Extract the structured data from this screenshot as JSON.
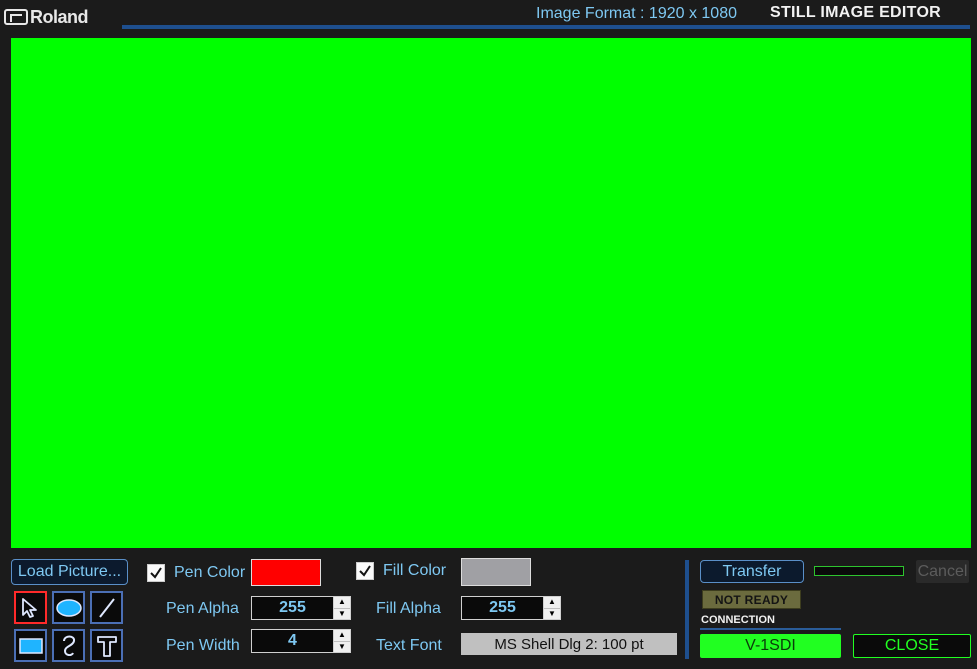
{
  "header": {
    "logo_text": "Roland",
    "image_format": "Image Format : 1920 x 1080",
    "title": "STILL IMAGE EDITOR",
    "accent_color": "#1e4f8e"
  },
  "canvas": {
    "background_color": "#00ff00"
  },
  "toolbar": {
    "load_picture_label": "Load Picture...",
    "tools": [
      {
        "name": "select-tool",
        "icon": "arrow-pointer-icon",
        "selected": true
      },
      {
        "name": "ellipse-tool",
        "icon": "ellipse-icon",
        "selected": false
      },
      {
        "name": "line-tool",
        "icon": "line-icon",
        "selected": false
      },
      {
        "name": "rectangle-tool",
        "icon": "rectangle-icon",
        "selected": false
      },
      {
        "name": "freehand-tool",
        "icon": "freehand-icon",
        "selected": false
      },
      {
        "name": "text-tool",
        "icon": "text-icon",
        "selected": false
      }
    ]
  },
  "pen": {
    "color_label": "Pen Color",
    "color_checked": true,
    "color_value": "#ff0000",
    "alpha_label": "Pen Alpha",
    "alpha_value": "255",
    "width_label": "Pen Width",
    "width_value": "4"
  },
  "fill": {
    "color_label": "Fill Color",
    "color_checked": true,
    "color_value": "#a0a0a4",
    "alpha_label": "Fill Alpha",
    "alpha_value": "255"
  },
  "text": {
    "font_label": "Text Font",
    "font_value": "MS Shell Dlg 2: 100 pt"
  },
  "transfer": {
    "transfer_label": "Transfer",
    "cancel_label": "Cancel",
    "progress": 0
  },
  "connection": {
    "status": "NOT READY",
    "label": "CONNECTION",
    "device": "V-1SDI",
    "close_label": "CLOSE"
  }
}
